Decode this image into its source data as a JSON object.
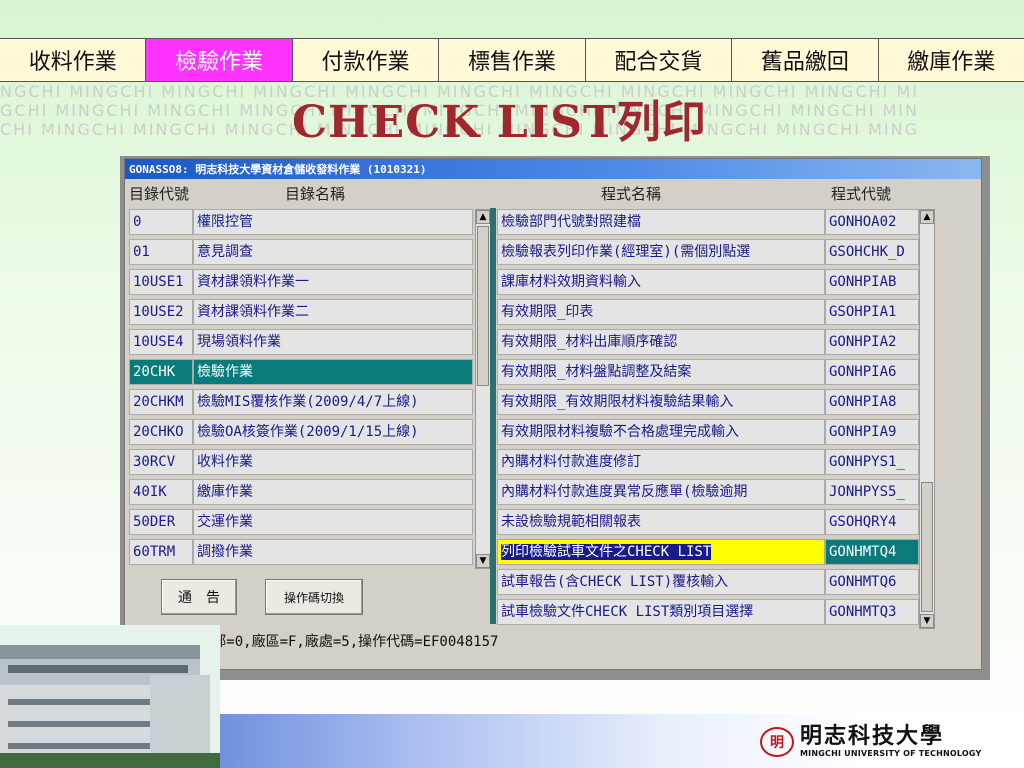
{
  "tabs": [
    {
      "label": "收料作業",
      "active": false
    },
    {
      "label": "檢驗作業",
      "active": true
    },
    {
      "label": "付款作業",
      "active": false
    },
    {
      "label": "標售作業",
      "active": false
    },
    {
      "label": "配合交貨",
      "active": false
    },
    {
      "label": "舊品繳回",
      "active": false
    },
    {
      "label": "繳庫作業",
      "active": false
    }
  ],
  "banner": {
    "title": "CHECK LIST列印",
    "watermark_lines": [
      "NGCHI MINGCHI MINGCHI MINGCHI MINGCHI MINGCHI MINGCHI MINGCHI MINGCHI MINGCHI MI",
      "GCHI MINGCHI MINGCHI MINGCHI MINGCHI MINGCHI MINGCHI MINGCHI MINGCHI MINGCHI MIN",
      "CHI MINGCHI MINGCHI MINGCHI MINGCHI MINGCHI MINGCHI MINGCHI MINGCHI MINGCHI MING"
    ]
  },
  "window": {
    "title": "GONASSO8: 明志科技大學資材倉儲收發料作業 (1010321)",
    "left_headers": {
      "code": "目錄代號",
      "name": "目錄名稱"
    },
    "right_headers": {
      "name": "程式名稱",
      "code": "程式代號"
    },
    "catalog": [
      {
        "code": "0",
        "name": "權限控管"
      },
      {
        "code": "01",
        "name": "意見調查"
      },
      {
        "code": "10USE1",
        "name": "資材課領料作業一"
      },
      {
        "code": "10USE2",
        "name": "資材課領料作業二"
      },
      {
        "code": "10USE4",
        "name": "現場領料作業"
      },
      {
        "code": "20CHK",
        "name": "檢驗作業"
      },
      {
        "code": "20CHKM",
        "name": "檢驗MIS覆核作業(2009/4/7上線)"
      },
      {
        "code": "20CHKO",
        "name": "檢驗OA核簽作業(2009/1/15上線)"
      },
      {
        "code": "30RCV",
        "name": "收料作業"
      },
      {
        "code": "40IK",
        "name": "繳庫作業"
      },
      {
        "code": "50DER",
        "name": "交運作業"
      },
      {
        "code": "60TRM",
        "name": "調撥作業"
      }
    ],
    "selected_catalog_index": 5,
    "programs": [
      {
        "name": "檢驗部門代號對照建檔",
        "code": "GONHOA02"
      },
      {
        "name": "檢驗報表列印作業(經理室)(需個別點選",
        "code": "GSOHCHK_D"
      },
      {
        "name": "課庫材料效期資料輸入",
        "code": "GONHPIAB"
      },
      {
        "name": "有效期限_印表",
        "code": "GSOHPIA1"
      },
      {
        "name": "有效期限_材料出庫順序確認",
        "code": "GONHPIA2"
      },
      {
        "name": "有效期限_材料盤點調整及結案",
        "code": "GONHPIA6"
      },
      {
        "name": "有效期限_有效期限材料複驗結果輸入",
        "code": "GONHPIA8"
      },
      {
        "name": "有效期限材料複驗不合格處理完成輸入",
        "code": "GONHPIA9"
      },
      {
        "name": "內購材料付款進度修訂",
        "code": "GONHPYS1_"
      },
      {
        "name": "內購材料付款進度異常反應單(檢驗逾期",
        "code": "JONHPYS5_"
      },
      {
        "name": "未設檢驗規範相關報表",
        "code": "GSOHQRY4"
      },
      {
        "name": "列印檢驗試車文件之CHECK LIST",
        "code": "GONHMTQ4"
      },
      {
        "name": "試車報告(含CHECK LIST)覆核輸入",
        "code": "GONHMTQ6"
      },
      {
        "name": "試車檢驗文件CHECK LIST類別項目選擇",
        "code": "GONHMTQ3"
      }
    ],
    "highlighted_program_index": 11,
    "buttons": {
      "notice": "通　告",
      "switch_code": "操作碼切換"
    },
    "status": "公司=E,事業部=0,廠區=F,廠處=5,操作代碼=EF0048157"
  },
  "logo": {
    "name": "明志科技大學",
    "english": "MINGCHI UNIVERSITY OF TECHNOLOGY",
    "accent": "#c0161c"
  },
  "colors": {
    "active_tab": "#ff33ff",
    "title_red": "#a0272d",
    "selection_teal": "#0b7a7a",
    "highlight_yellow": "#ffff00"
  }
}
